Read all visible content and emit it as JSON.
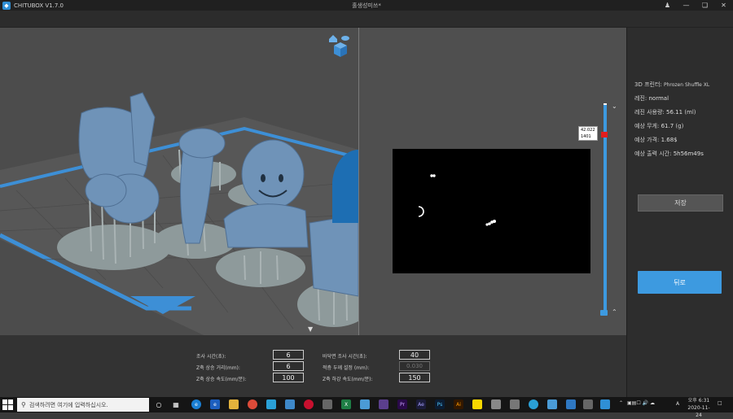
{
  "app": {
    "name": "CHITUBOX V1.7.0",
    "document": "홀생성미쓰*"
  },
  "window_controls": [
    "user-icon",
    "minimize-icon",
    "restore-icon",
    "close-icon"
  ],
  "slice_view": {
    "layer_height": "42.022",
    "layer_index": "1401"
  },
  "info": {
    "printer_label": "3D 프린터:",
    "printer_value": "Phrozen Shuffle XL",
    "resin_label": "레진:",
    "resin_value": "normal",
    "volume_label": "레진 사용량:",
    "volume_value": "56.11",
    "volume_unit": "(ml)",
    "weight_label": "예상 무게:",
    "weight_value": "61.7",
    "weight_unit": "(g)",
    "price_label": "예상 가격:",
    "price_value": "1.68$",
    "time_label": "예상 출력 시간:",
    "time_value": "5h56m49s"
  },
  "buttons": {
    "save": "저장",
    "back": "뒤로"
  },
  "params": {
    "exposure_label": "조사 시간(초):",
    "exposure_value": "6",
    "bottom_exposure_label": "바닥면 조사 시간(초):",
    "bottom_exposure_value": "40",
    "lift_distance_label": "Z축 상승 거리(mm):",
    "lift_distance_value": "6",
    "layer_thickness_label": "적층 두께 설정 (mm):",
    "layer_thickness_value": "0.030",
    "lift_speed_label": "Z축 상승 속도(mm/분):",
    "lift_speed_value": "100",
    "retract_speed_label": "Z축 하강 속도(mm/분):",
    "retract_speed_value": "150"
  },
  "taskbar": {
    "search_placeholder": "검색하려면 여기에 입력하십시오.",
    "time": "오후 6:31",
    "date": "2020-11-24",
    "lang": "A"
  },
  "colors": {
    "accent": "#3d9ae0",
    "model": "#6f93b8",
    "support": "#9aa7a8",
    "bed": "#5a5a5a",
    "bed_border": "#3d8fd6"
  }
}
